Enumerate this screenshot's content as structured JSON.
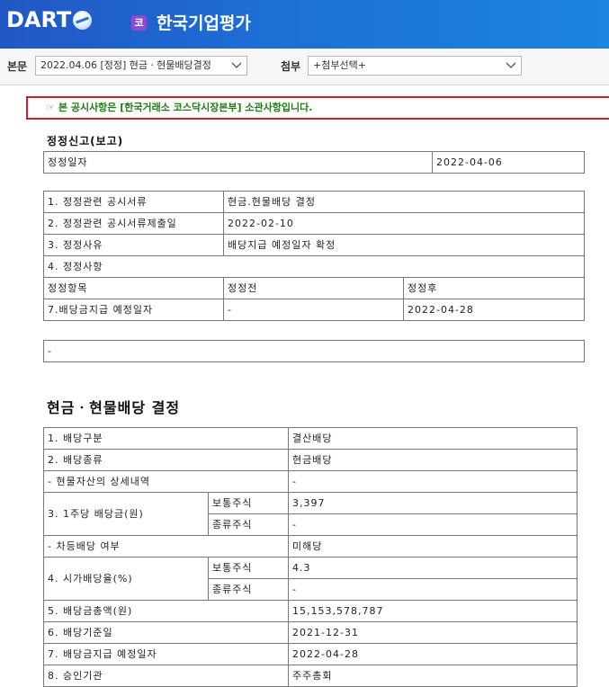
{
  "header": {
    "logo_text": "DART",
    "corp_badge": "코",
    "corp_name": "한국기업평가"
  },
  "toolbar": {
    "main_label": "본문",
    "main_select": "2022.04.06  [정정] 현금ㆍ현물배당결정",
    "attach_label": "첨부",
    "attach_select": "+첨부선택+"
  },
  "notice": {
    "icon": "pointing-hand-icon",
    "text": "본 공시사항은 [한국거래소 코스닥시장본부] 소관사항입니다."
  },
  "correction": {
    "title": "정정신고(보고)",
    "date_label": "정정일자",
    "date_value": "2022-04-06",
    "rows": [
      {
        "label": "1. 정정관련 공시서류",
        "value": "현금.현물배당 결정"
      },
      {
        "label": "2. 정정관련 공시서류제출일",
        "value": "2022-02-10"
      },
      {
        "label": "3. 정정사유",
        "value": "배당지급 예정일자 확정"
      }
    ],
    "items_label": "4. 정정사항",
    "col_item": "정정항목",
    "col_before": "정정전",
    "col_after": "정정후",
    "change_item": "7.배당금지급 예정일자",
    "change_before": "-",
    "change_after": "2022-04-28",
    "remark": "-"
  },
  "dividend": {
    "title": "현금ㆍ현물배당 결정",
    "r1_label": "1. 배당구분",
    "r1_value": "결산배당",
    "r2_label": "2. 배당종류",
    "r2_value": "현금배당",
    "r3_label": "- 현물자산의 상세내역",
    "r3_value": "-",
    "r4_label": "3. 1주당 배당금(원)",
    "common_label": "보통주식",
    "r4_common": "3,397",
    "preferred_label": "종류주식",
    "r4_preferred": "-",
    "r5_label": "- 차등배당 여부",
    "r5_value": "미해당",
    "r6_label": "4. 시가배당율(%)",
    "r6_common": "4.3",
    "r6_preferred": "-",
    "r7_label": "5. 배당금총액(원)",
    "r7_value": "15,153,578,787",
    "r8_label": "6. 배당기준일",
    "r8_value": "2021-12-31",
    "r9_label": "7. 배당금지급 예정일자",
    "r9_value": "2022-04-28",
    "r10_label": "8. 승인기관",
    "r10_value": "주주총회"
  }
}
